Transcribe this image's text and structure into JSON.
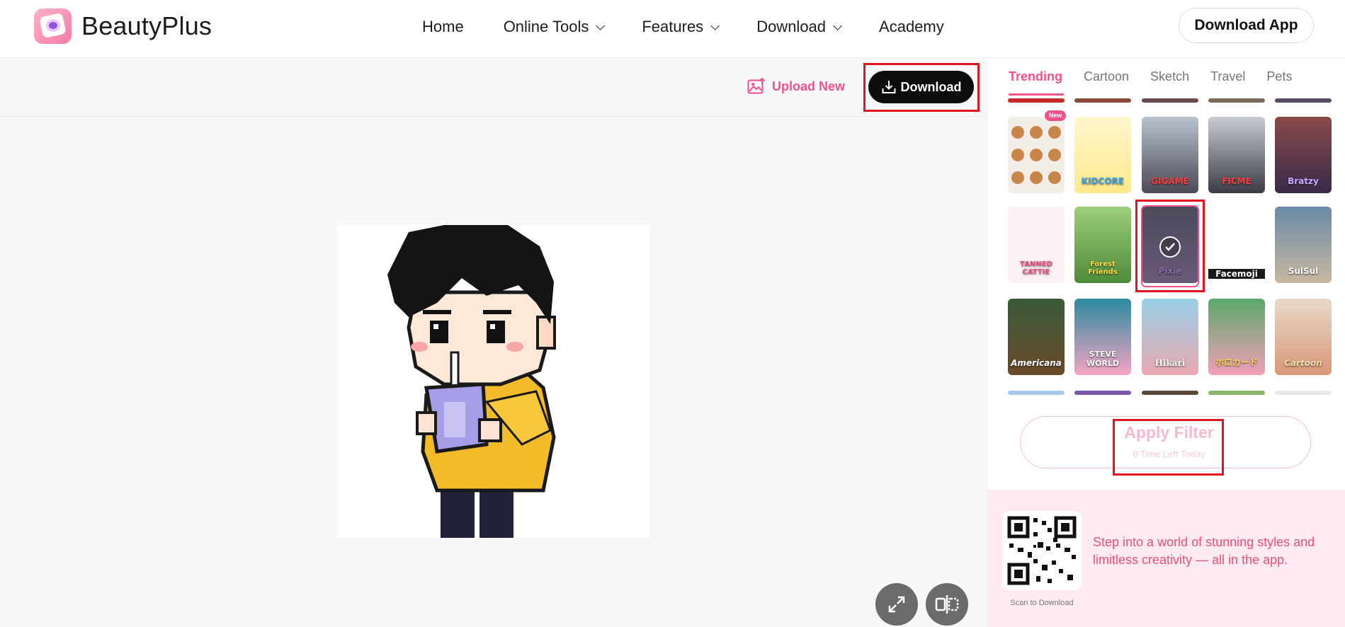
{
  "header": {
    "logo_text": "BeautyPlus",
    "nav": [
      {
        "label": "Home",
        "has_dropdown": false
      },
      {
        "label": "Online Tools",
        "has_dropdown": true
      },
      {
        "label": "Features",
        "has_dropdown": true
      },
      {
        "label": "Download",
        "has_dropdown": true
      },
      {
        "label": "Academy",
        "has_dropdown": false
      }
    ],
    "download_app_label": "Download App"
  },
  "toolbar": {
    "upload_new_label": "Upload New",
    "download_label": "Download"
  },
  "panel": {
    "tabs": [
      "Trending",
      "Cartoon",
      "Sketch",
      "Travel",
      "Pets"
    ],
    "active_tab": "Trending",
    "new_badge": "New",
    "filters": [
      {
        "label": "",
        "selected": false
      },
      {
        "label": "KIDCORE",
        "selected": false
      },
      {
        "label": "GIGAME",
        "selected": false
      },
      {
        "label": "FICME",
        "selected": false
      },
      {
        "label": "Bratzy",
        "selected": false
      },
      {
        "label": "TANNED CATTIE",
        "selected": false
      },
      {
        "label": "Forest Friends",
        "selected": false
      },
      {
        "label": "Pixie",
        "selected": true
      },
      {
        "label": "Facemoji",
        "selected": false
      },
      {
        "label": "SulSul",
        "selected": false
      },
      {
        "label": "Americana",
        "selected": false
      },
      {
        "label": "STEVE WORLD",
        "selected": false
      },
      {
        "label": "Hikari",
        "selected": false
      },
      {
        "label": "ホロカード",
        "selected": false
      },
      {
        "label": "Cartoon",
        "selected": false
      }
    ],
    "apply_filter_label": "Apply Filter",
    "apply_filter_sub": "0 Time Left Today"
  },
  "promo": {
    "qr_caption": "Scan to Download",
    "text": "Step into a world of stunning styles and limitless creativity — all in the app."
  },
  "colors": {
    "accent": "#f2508a",
    "highlight": "#e0141e",
    "promo_bg": "#fdebef"
  }
}
